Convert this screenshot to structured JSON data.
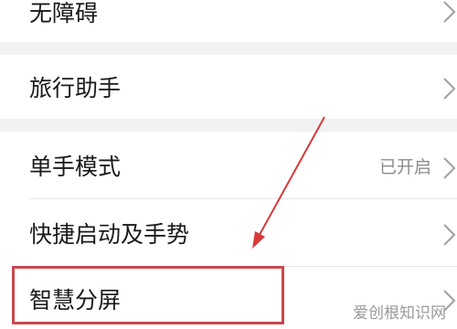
{
  "settings": {
    "items": [
      {
        "label": "无障碍"
      },
      {
        "label": "旅行助手"
      },
      {
        "label": "单手模式",
        "value": "已开启"
      },
      {
        "label": "快捷启动及手势"
      },
      {
        "label": "智慧分屏"
      }
    ]
  },
  "annotation": {
    "color": "#d83a3a"
  },
  "watermark": {
    "text": "爱创根知识网"
  }
}
